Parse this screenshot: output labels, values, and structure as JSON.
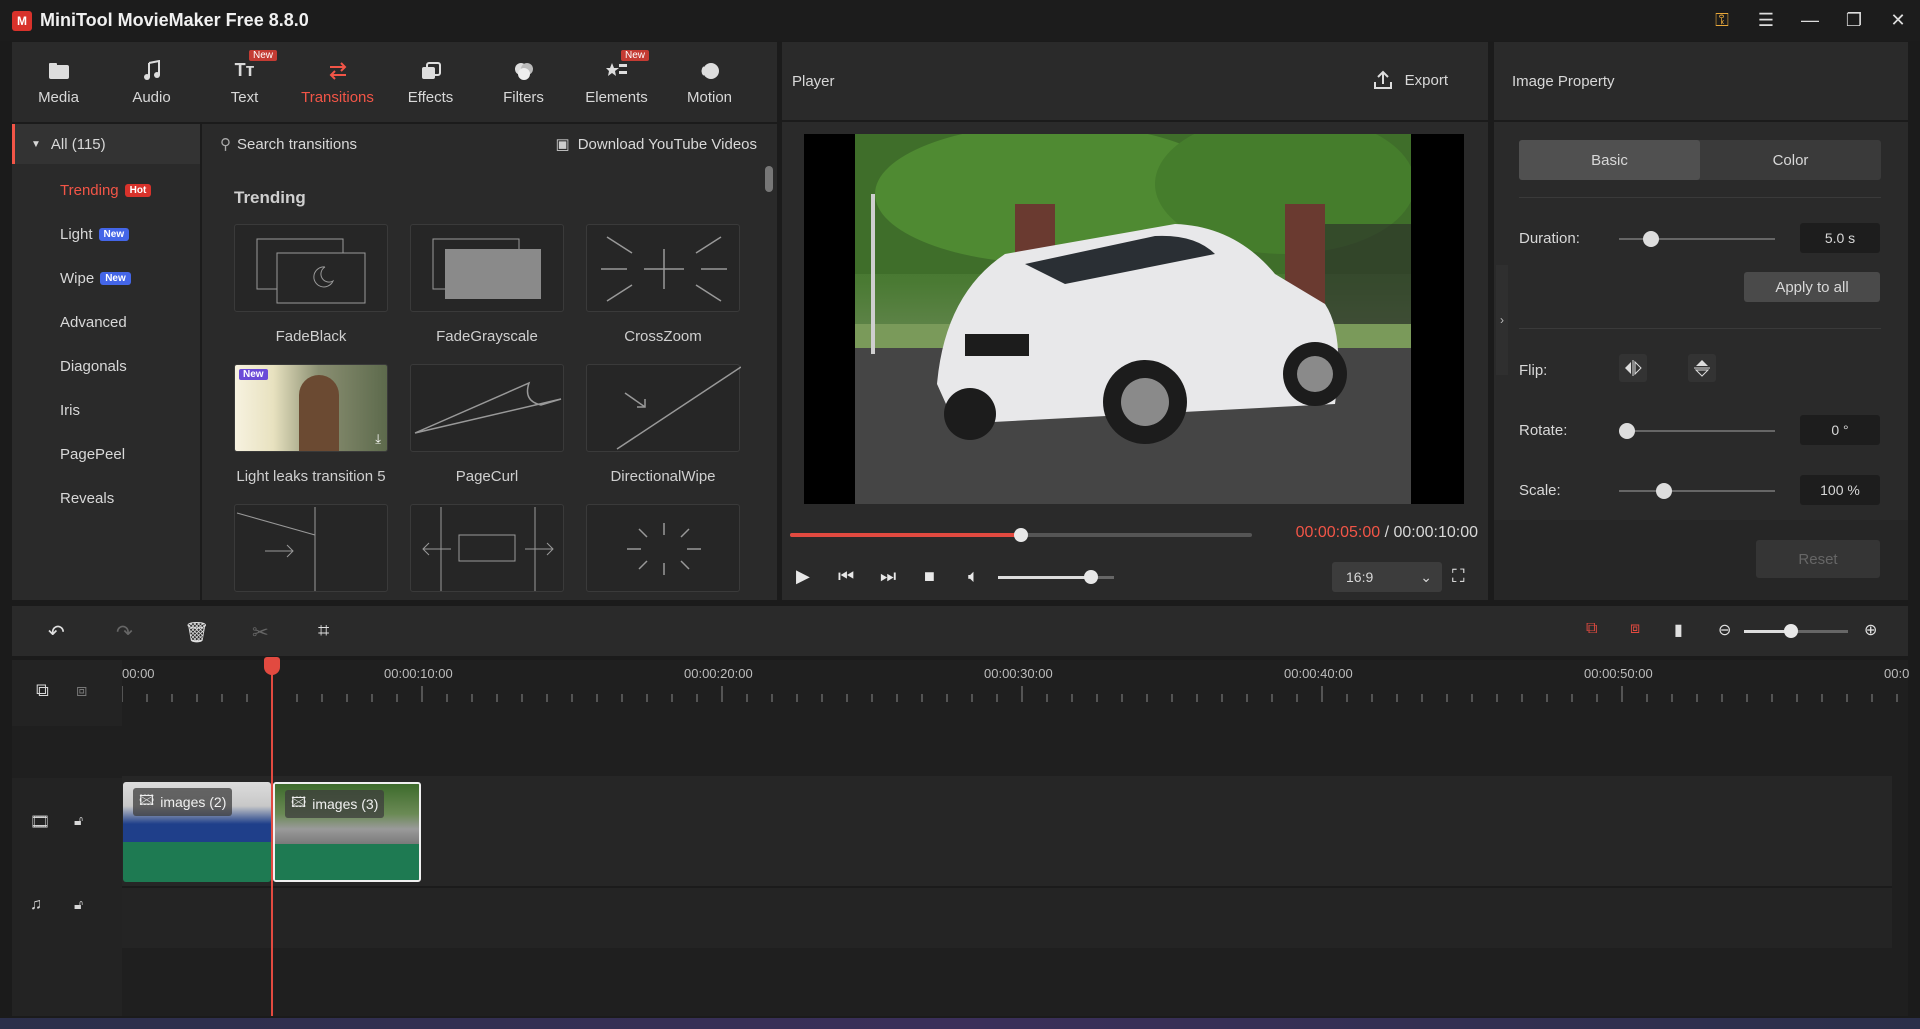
{
  "app": {
    "title": "MiniTool MovieMaker Free 8.8.0"
  },
  "toolbar": {
    "items": [
      {
        "label": "Media",
        "badge": ""
      },
      {
        "label": "Audio",
        "badge": ""
      },
      {
        "label": "Text",
        "badge": "New"
      },
      {
        "label": "Transitions",
        "badge": ""
      },
      {
        "label": "Effects",
        "badge": ""
      },
      {
        "label": "Filters",
        "badge": ""
      },
      {
        "label": "Elements",
        "badge": "New"
      },
      {
        "label": "Motion",
        "badge": ""
      }
    ],
    "active": "Transitions"
  },
  "categories": {
    "all_label": "All (115)",
    "items": [
      {
        "label": "Trending",
        "tag": "Hot"
      },
      {
        "label": "Light",
        "tag": "New"
      },
      {
        "label": "Wipe",
        "tag": "New"
      },
      {
        "label": "Advanced",
        "tag": ""
      },
      {
        "label": "Diagonals",
        "tag": ""
      },
      {
        "label": "Iris",
        "tag": ""
      },
      {
        "label": "PagePeel",
        "tag": ""
      },
      {
        "label": "Reveals",
        "tag": ""
      }
    ]
  },
  "transitions": {
    "search_placeholder": "Search transitions",
    "download_label": "Download YouTube Videos",
    "section_title": "Trending",
    "items": [
      {
        "label": "FadeBlack"
      },
      {
        "label": "FadeGrayscale"
      },
      {
        "label": "CrossZoom"
      },
      {
        "label": "Light leaks transition 5",
        "badge": "New"
      },
      {
        "label": "PageCurl"
      },
      {
        "label": "DirectionalWipe"
      }
    ]
  },
  "player": {
    "title": "Player",
    "export_label": "Export",
    "current_time": "00:00:05:00",
    "separator": " / ",
    "total_time": "00:00:10:00",
    "progress": 0.5,
    "volume": 0.8,
    "aspect_ratio": "16:9"
  },
  "property": {
    "title": "Image Property",
    "tabs": [
      "Basic",
      "Color"
    ],
    "active_tab": "Basic",
    "duration_label": "Duration:",
    "duration_value": "5.0 s",
    "apply_all_label": "Apply to all",
    "flip_label": "Flip:",
    "rotate_label": "Rotate:",
    "rotate_value": "0 °",
    "scale_label": "Scale:",
    "scale_value": "100 %",
    "reset_label": "Reset"
  },
  "timeline": {
    "ticks": [
      "00:00",
      "00:00:10:00",
      "00:00:20:00",
      "00:00:30:00",
      "00:00:40:00",
      "00:00:50:00",
      "00:0"
    ],
    "clips": [
      {
        "label": "images (2)"
      },
      {
        "label": "images (3)"
      }
    ]
  },
  "colors": {
    "accent": "#f25547",
    "clip_green": "#1e7a52"
  }
}
